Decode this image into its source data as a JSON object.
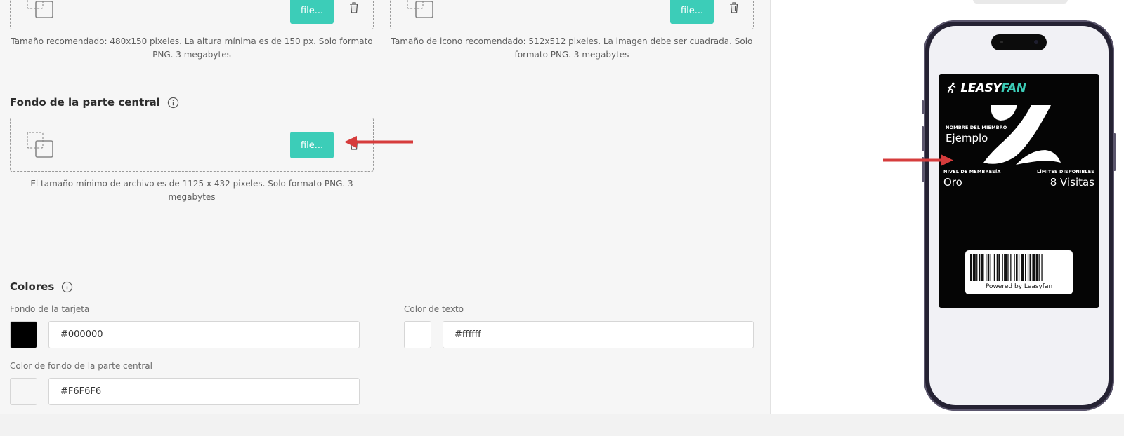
{
  "uploads": {
    "top_left_button": "file...",
    "top_left_hint": "Tamaño recomendado: 480x150 pixeles. La altura mínima es de 150 px. Solo formato PNG. 3 megabytes",
    "top_right_button": "file...",
    "top_right_hint": "Tamaño de icono recomendado: 512x512 pixeles. La imagen debe ser cuadrada. Solo formato PNG. 3 megabytes"
  },
  "central_background": {
    "title": "Fondo de la parte central",
    "button": "file...",
    "hint": "El tamaño mínimo de archivo es de 1125 x 432 pixeles. Solo formato PNG. 3 megabytes"
  },
  "colors": {
    "title": "Colores",
    "card_bg_label": "Fondo de la tarjeta",
    "card_bg_value": "#000000",
    "text_color_label": "Color de texto",
    "text_color_value": "#ffffff",
    "central_bg_label": "Color de fondo de la parte central",
    "central_bg_value": "#F6F6F6"
  },
  "preview": {
    "brand_left": "LEASY",
    "brand_right": "FAN",
    "member_name_label": "NOMBRE DEL MIEMBRO",
    "member_name_value": "Ejemplo",
    "level_label": "NIVEL DE MEMBRESÍA",
    "level_value": "Oro",
    "limits_label": "LÍMITES DISPONIBLES",
    "limits_value": "8 Visitas",
    "barcode_caption": "Powered by Leasyfan"
  },
  "accent_color": "#3ccdb8",
  "annotation_color": "#d63c3c"
}
